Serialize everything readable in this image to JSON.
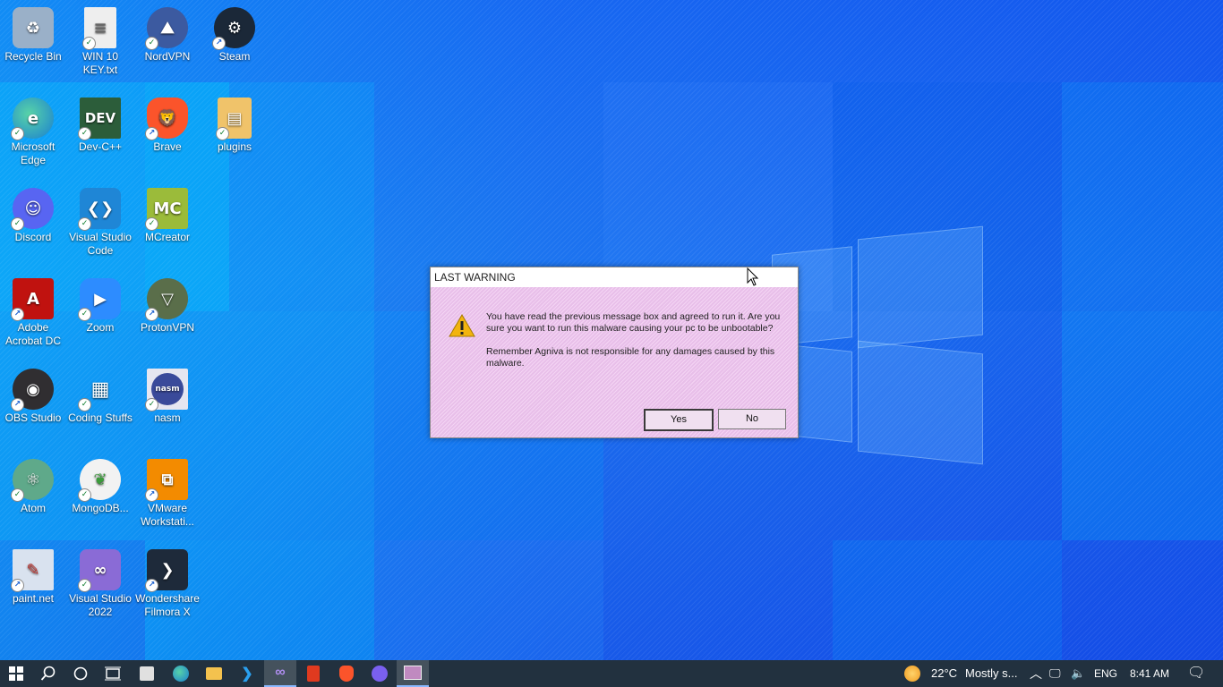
{
  "desktop": {
    "icons": [
      {
        "label": "Recycle Bin",
        "icon": "recycle-bin-icon",
        "color": "#9ab0c8"
      },
      {
        "label": "WIN 10 KEY.txt",
        "icon": "text-file-icon",
        "color": "#e8e8e8"
      },
      {
        "label": "NordVPN",
        "icon": "nordvpn-icon",
        "color": "#3c5aa0"
      },
      {
        "label": "Steam",
        "icon": "steam-icon",
        "color": "#1b2838"
      },
      {
        "label": "Microsoft Edge",
        "icon": "edge-icon",
        "color": "#1fa56b"
      },
      {
        "label": "Dev-C++",
        "icon": "devcpp-icon",
        "color": "#2c5d3a"
      },
      {
        "label": "Brave",
        "icon": "brave-icon",
        "color": "#fb542b"
      },
      {
        "label": "plugins",
        "icon": "folder-icon",
        "color": "#f0c36a"
      },
      {
        "label": "Discord",
        "icon": "discord-icon",
        "color": "#5865f2"
      },
      {
        "label": "Visual Studio Code",
        "icon": "vscode-icon",
        "color": "#1f86d6"
      },
      {
        "label": "MCreator",
        "icon": "mcreator-icon",
        "color": "#9bbb3a"
      },
      {
        "label": "Adobe Acrobat DC",
        "icon": "acrobat-icon",
        "color": "#c0120f"
      },
      {
        "label": "Zoom",
        "icon": "zoom-icon",
        "color": "#2d8cff"
      },
      {
        "label": "ProtonVPN",
        "icon": "protonvpn-icon",
        "color": "#5a6e4a"
      },
      {
        "label": "OBS Studio",
        "icon": "obs-icon",
        "color": "#302e31"
      },
      {
        "label": "Coding Stuffs",
        "icon": "folder-chip-icon",
        "color": "#5a8a3a"
      },
      {
        "label": "nasm",
        "icon": "nasm-icon",
        "color": "#3a4a9a"
      },
      {
        "label": "Atom",
        "icon": "atom-icon",
        "color": "#5fa98a"
      },
      {
        "label": "MongoDB...",
        "icon": "mongodb-icon",
        "color": "#f2f2f2"
      },
      {
        "label": "VMware Workstati...",
        "icon": "vmware-icon",
        "color": "#f38b00"
      },
      {
        "label": "paint.net",
        "icon": "paintnet-icon",
        "color": "#d9e2ef"
      },
      {
        "label": "Visual Studio 2022",
        "icon": "visual-studio-icon",
        "color": "#8a6bd6"
      },
      {
        "label": "Wondershare Filmora X",
        "icon": "filmora-icon",
        "color": "#1e2a3a"
      }
    ]
  },
  "dialog": {
    "title": "LAST WARNING",
    "message1": "You have read the previous message box and agreed to run it. Are you sure you want to run this malware causing your pc to be unbootable?",
    "message2": "Remember Agniva is not responsible for any damages caused by this malware.",
    "yes_label": "Yes",
    "no_label": "No"
  },
  "taskbar": {
    "weather_temp": "22°C",
    "weather_text": "Mostly s...",
    "language": "ENG",
    "time": "8:41 AM"
  }
}
